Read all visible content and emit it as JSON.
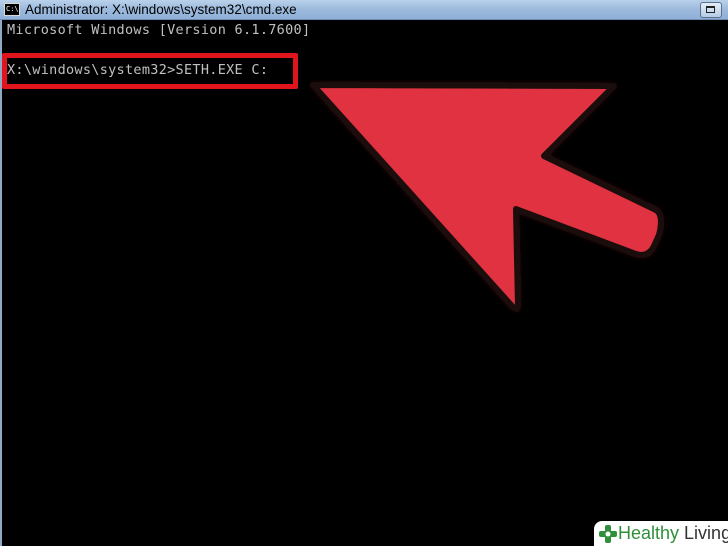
{
  "window": {
    "title": "Administrator: X:\\windows\\system32\\cmd.exe",
    "icon_text": "C:\\",
    "maximize_icon": "maximize-icon"
  },
  "console": {
    "lines": [
      "Microsoft Windows [Version 6.1.7600]",
      "X:\\windows\\system32>SETH.EXE C:"
    ]
  },
  "annotation": {
    "highlight_color": "#e0141c",
    "arrow_color": "#e03040",
    "arrow_icon": "pointer-arrow-icon"
  },
  "watermark": {
    "brand_word_1": "Healthy",
    "brand_word_2": "Living",
    "brand_color": "#2f8f3a"
  }
}
